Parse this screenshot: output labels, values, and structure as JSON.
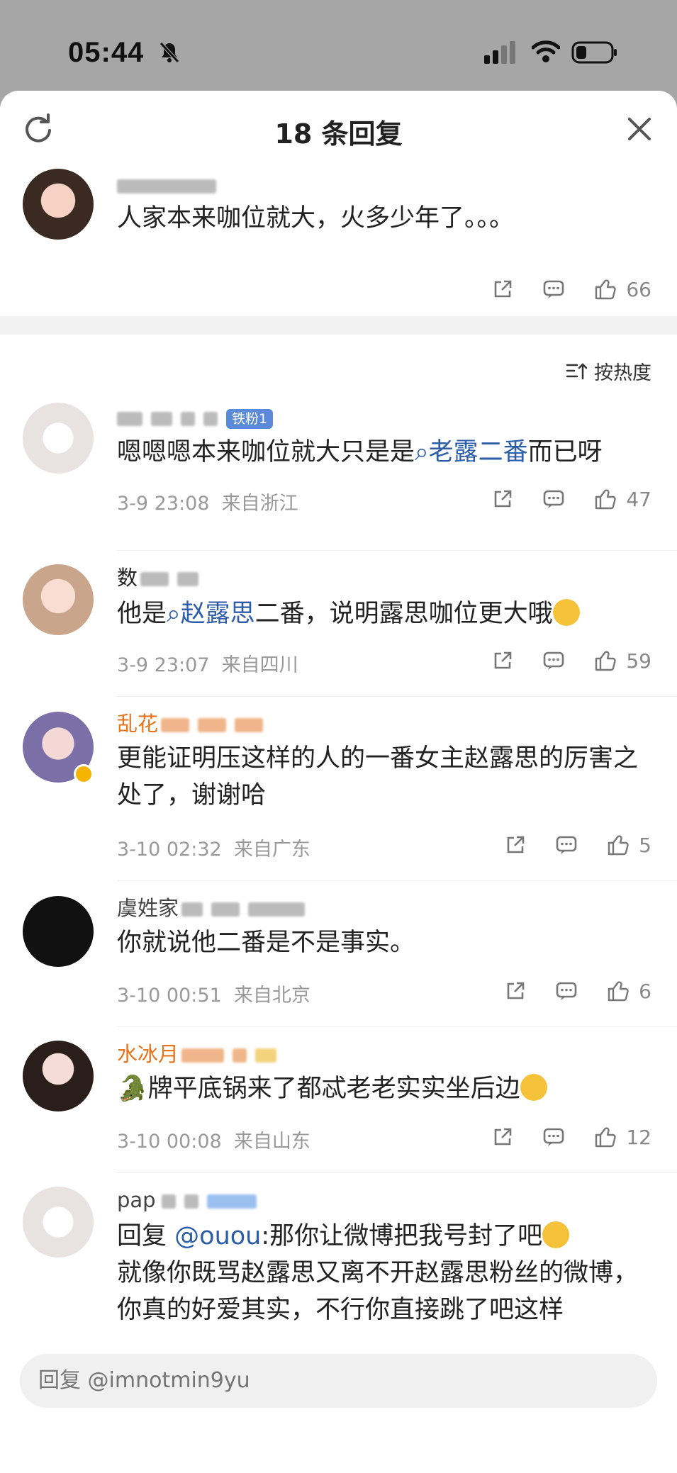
{
  "status_bar": {
    "time": "05:44"
  },
  "sheet": {
    "title": "18 条回复"
  },
  "top_comment": {
    "name": "imnotmin9yu",
    "text": "人家本来咖位就大，火多少年了。。。",
    "likes": "66"
  },
  "sort": {
    "label": "按热度"
  },
  "replies": [
    {
      "name": "",
      "badge": "铁粉1",
      "text_before": "嗯嗯嗯本来咖位就大只是是",
      "topic": "老露二番",
      "text_after": "而已呀",
      "time": "3-9 23:08",
      "location": "来自浙江",
      "likes": "47"
    },
    {
      "name": "数",
      "text_before": "他是",
      "topic": "赵露思",
      "text_after": "二番，说明露思咖位更大哦",
      "time": "3-9 23:07",
      "location": "来自四川",
      "likes": "59"
    },
    {
      "name": "乱花",
      "text": "更能证明压这样的人的一番女主赵露思的厉害之处了，谢谢哈",
      "time": "3-10 02:32",
      "location": "来自广东",
      "likes": "5"
    },
    {
      "name": "虞姓家",
      "text": "你就说他二番是不是事实。",
      "time": "3-10 00:51",
      "location": "来自北京",
      "likes": "6"
    },
    {
      "name": "水冰月",
      "text": "牌平底锅来了都忒老老实实坐后边",
      "time": "3-10 00:08",
      "location": "来自山东",
      "likes": "12"
    },
    {
      "name": "pap",
      "reply_prefix": "回复",
      "mention": "@ouou",
      "text_line1": ":那你让微博把我号封了吧",
      "text_rest": "就像你既骂赵露思又离不开赵露思粉丝的微博，你真的好爱其实，不行你直接跳了吧这样"
    }
  ],
  "reply_box": {
    "placeholder": "回复 @imnotmin9yu"
  },
  "colors": {
    "link": "#2c5ea8",
    "orange_name": "#e8731a",
    "meta_gray": "#999999",
    "badge_blue": "#5b8ad8"
  }
}
